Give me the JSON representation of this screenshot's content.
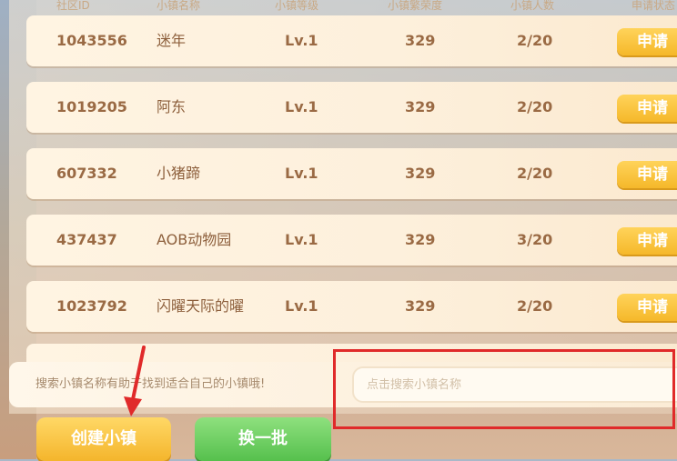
{
  "header": {
    "community_id": "社区ID",
    "town_name": "小镇名称",
    "town_level": "小镇等级",
    "prosperity": "小镇繁荣度",
    "population": "小镇人数",
    "status": "申请状态"
  },
  "rows": [
    {
      "id": "1043556",
      "name": "迷年",
      "level": "Lv.1",
      "prosperity": "329",
      "population": "2/20",
      "action": "申请"
    },
    {
      "id": "1019205",
      "name": "阿东",
      "level": "Lv.1",
      "prosperity": "329",
      "population": "2/20",
      "action": "申请"
    },
    {
      "id": "607332",
      "name": "小猪蹄",
      "level": "Lv.1",
      "prosperity": "329",
      "population": "2/20",
      "action": "申请"
    },
    {
      "id": "437437",
      "name": "AOB动物园",
      "level": "Lv.1",
      "prosperity": "329",
      "population": "3/20",
      "action": "申请"
    },
    {
      "id": "1023792",
      "name": "闪曜天际的曜",
      "level": "Lv.1",
      "prosperity": "329",
      "population": "2/20",
      "action": "申请"
    }
  ],
  "search": {
    "hint": "搜索小镇名称有助于找到适合自己的小镇哦!",
    "placeholder": "点击搜索小镇名称"
  },
  "buttons": {
    "create": "创建小镇",
    "refresh": "换一批"
  },
  "colors": {
    "annotation_box": "#e02a2a",
    "apply_button": "#f5b82a",
    "refresh_button": "#56c04d"
  }
}
